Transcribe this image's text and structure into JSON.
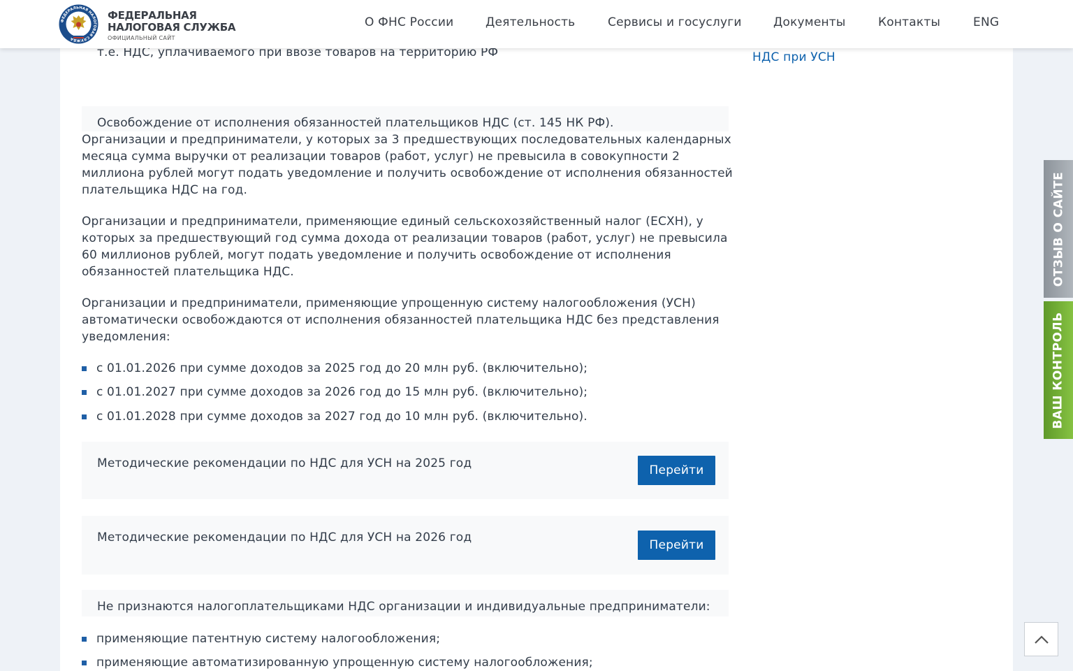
{
  "header": {
    "logo_line1": "ФЕДЕРАЛЬНАЯ",
    "logo_line2": "НАЛОГОВАЯ СЛУЖБА",
    "logo_sub": "ОФИЦИАЛЬНЫЙ САЙТ",
    "emblem_ring_text": "ФЕДЕРАЛЬНАЯ НАЛОГОВАЯ СЛУЖБА",
    "nav": [
      "О ФНС России",
      "Деятельность",
      "Сервисы и госуслуги",
      "Документы",
      "Контакты",
      "ENG"
    ]
  },
  "content": {
    "top_fragment": "т.е. НДС, уплачиваемого при ввозе товаров на территорию РФ",
    "exemption_title": "Освобождение от исполнения обязанностей плательщиков НДС (ст. 145 НК РФ).",
    "para1_lines": [
      "Организации и предприниматели, у которых за 3 предшествующих последовательных календарных",
      "месяца сумма выручки от реализации товаров (работ, услуг) не превысила в совокупности 2",
      "миллиона рублей могут подать уведомление и получить освобождение от исполнения обязанностей",
      "плательщика НДС на год."
    ],
    "para2_lines": [
      "Организации и предприниматели, применяющие единый сельскохозяйственный налог (ЕСХН), у",
      "которых за предшествующий год сумма дохода от реализации товаров (работ, услуг) не превысила",
      "60 миллионов рублей, могут подать уведомление и получить освобождение от исполнения",
      "обязанностей плательщика НДС."
    ],
    "para3_lines": [
      "Организации и предприниматели, применяющие упрощенную систему налогообложения (УСН)",
      "автоматически освобождаются от исполнения обязанностей плательщика НДС без представления",
      "уведомления:"
    ],
    "bullets1": [
      "с 01.01.2026 при сумме доходов за 2025 год до 20 млн руб. (включительно);",
      "с 01.01.2027 при сумме доходов за 2026 год до 15 млн руб. (включительно);",
      "с 01.01.2028 при сумме доходов за 2027 год до 10 млн руб. (включительно)."
    ],
    "method_cards": [
      {
        "title": "Методические рекомендации по НДС для УСН на 2025 год",
        "button": "Перейти"
      },
      {
        "title": "Методические рекомендации по НДС для УСН на 2026 год",
        "button": "Перейти"
      }
    ],
    "non_payers_title": "Не признаются налогоплательщиками НДС организации и индивидуальные предприниматели:",
    "bullets2": [
      "применяющие патентную систему налогообложения;",
      "применяющие автоматизированную упрощенную систему налогообложения;"
    ]
  },
  "sidebar": {
    "link": "НДС при УСН"
  },
  "side_tabs": {
    "feedback": "ОТЗЫВ О САЙТЕ",
    "control": "ВАШ КОНТРОЛЬ"
  },
  "icons": {
    "scroll_top": "chevron-up-icon",
    "emblem": "emblem-icon"
  },
  "colors": {
    "accent": "#0e62ad",
    "feedback_tab": "#9aa1a8",
    "control_tab": "#74b337"
  }
}
